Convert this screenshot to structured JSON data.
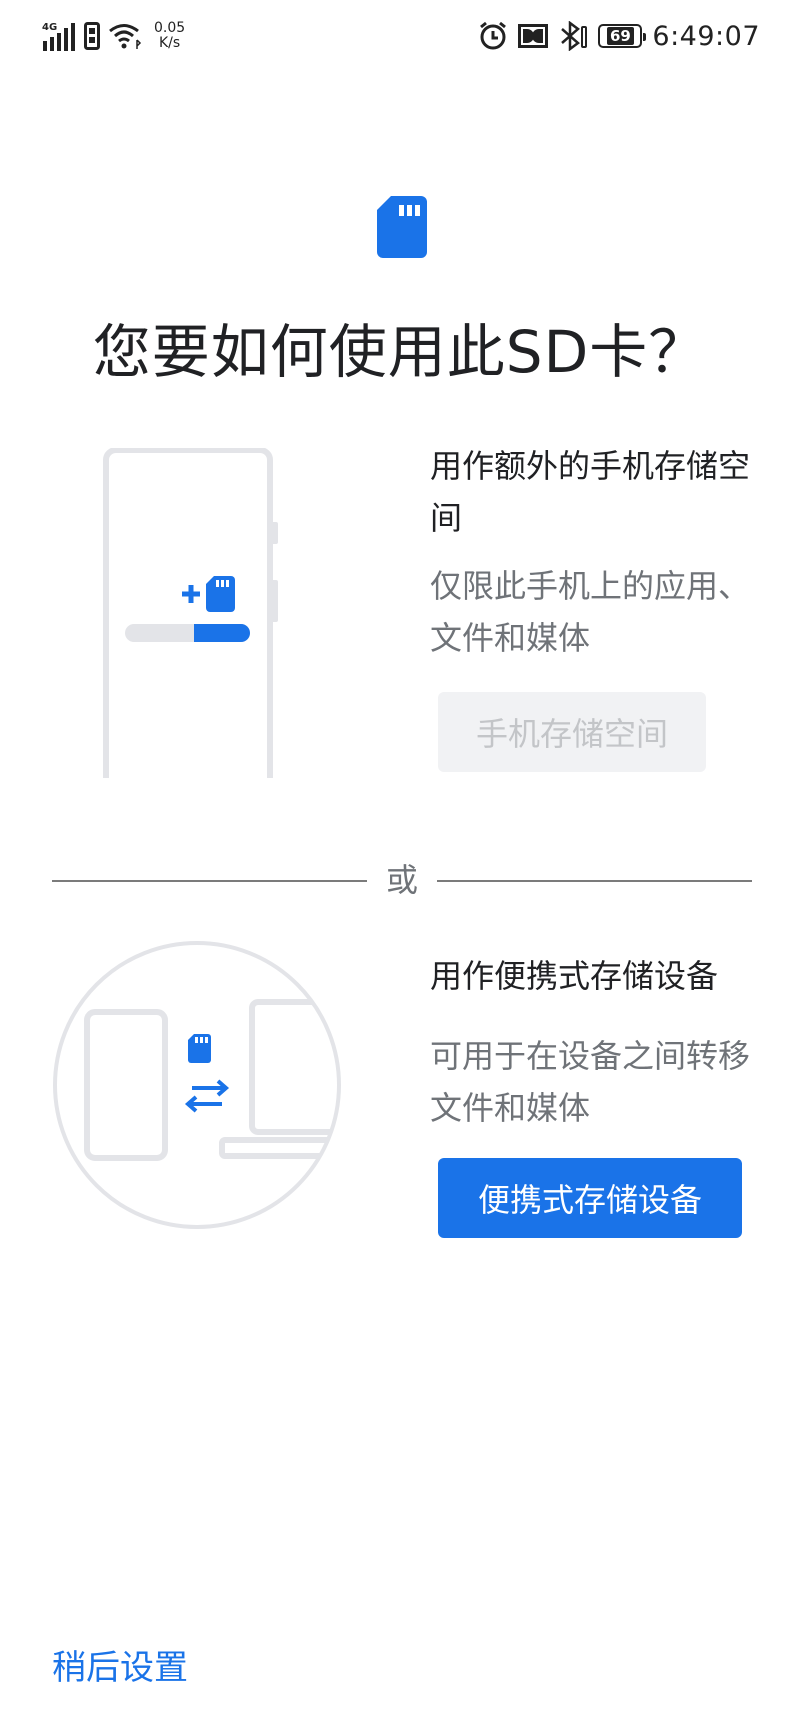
{
  "status_bar": {
    "network_type": "4G",
    "speed_value": "0.05",
    "speed_unit": "K/s",
    "battery_level": "69",
    "time": "6:49:07",
    "icons": [
      "signal-icon",
      "sim-icon",
      "wifi-icon",
      "alarm-icon",
      "dolby-icon",
      "bluetooth-icon",
      "battery-icon"
    ]
  },
  "header": {
    "icon": "sd-card-icon",
    "title": "您要如何使用此SD卡？"
  },
  "option_internal": {
    "title": "用作额外的手机存储空间",
    "description": "仅限此手机上的应用、文件和媒体",
    "button_label": "手机存储空间",
    "illustration": "phone-storage-illustration"
  },
  "divider": {
    "label": "或"
  },
  "option_portable": {
    "title": "用作便携式存储设备",
    "description": "可用于在设备之间转移文件和媒体",
    "button_label": "便携式存储设备",
    "illustration": "portable-transfer-illustration"
  },
  "footer": {
    "later_label": "稍后设置"
  },
  "colors": {
    "accent": "#1a73e8",
    "text_primary": "#202124",
    "text_secondary": "#6f7378",
    "disabled_bg": "#f1f2f4",
    "disabled_text": "#c3c5c8"
  }
}
